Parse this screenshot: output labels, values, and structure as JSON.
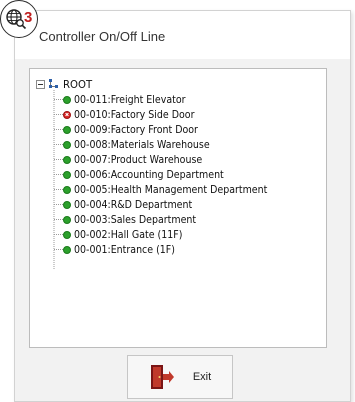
{
  "badge": {
    "count": "3",
    "icon": "globe-search-icon"
  },
  "window": {
    "title": "Controller On/Off Line"
  },
  "tree": {
    "root_label": "ROOT",
    "items": [
      {
        "label": "00-011:Freight Elevator",
        "status": "online"
      },
      {
        "label": "00-010:Factory Side Door",
        "status": "offline"
      },
      {
        "label": "00-009:Factory Front Door",
        "status": "online"
      },
      {
        "label": "00-008:Materials Warehouse",
        "status": "online"
      },
      {
        "label": "00-007:Product Warehouse",
        "status": "online"
      },
      {
        "label": "00-006:Accounting Department",
        "status": "online"
      },
      {
        "label": "00-005:Health Management Department",
        "status": "online"
      },
      {
        "label": "00-004:R&D Department",
        "status": "online"
      },
      {
        "label": "00-003:Sales Department",
        "status": "online"
      },
      {
        "label": "00-002:Hall Gate (11F)",
        "status": "online"
      },
      {
        "label": "00-001:Entrance (1F)",
        "status": "online"
      }
    ]
  },
  "colors": {
    "online": "#2ca02c",
    "offline": "#d62828",
    "exit_door": "#b22222"
  },
  "exit_button": {
    "label": "Exit",
    "icon": "exit-door-icon"
  }
}
